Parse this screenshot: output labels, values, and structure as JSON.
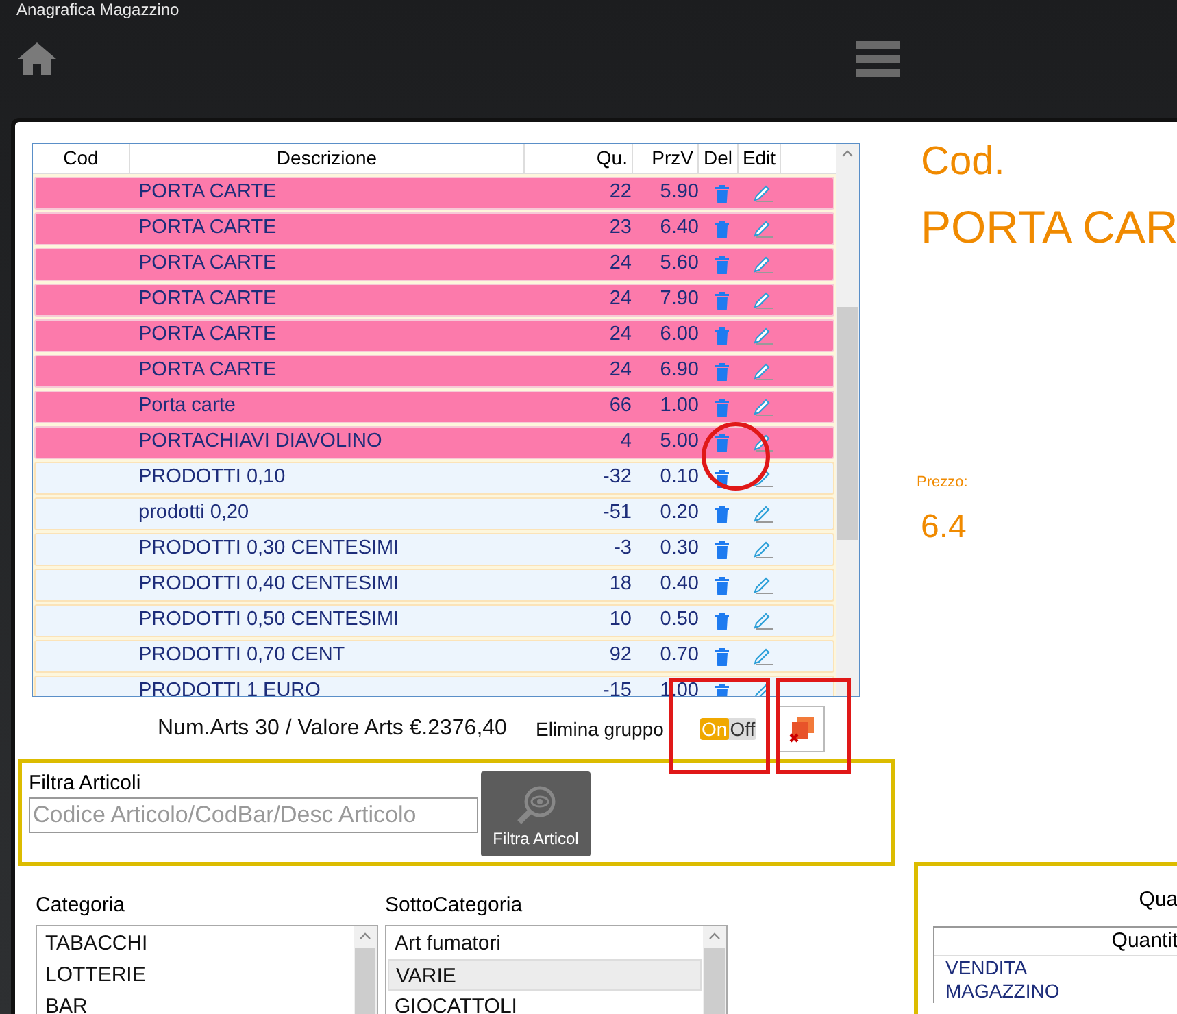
{
  "window": {
    "title": "Anagrafica Magazzino"
  },
  "table": {
    "columns": [
      "Cod",
      "Descrizione",
      "Qu.",
      "PrzV",
      "Del",
      "Edit"
    ],
    "rows": [
      {
        "description": "PORTA CARTE",
        "qty": "22",
        "price": "5.90",
        "selected": true
      },
      {
        "description": "PORTA CARTE",
        "qty": "23",
        "price": "6.40",
        "selected": true
      },
      {
        "description": "PORTA CARTE",
        "qty": "24",
        "price": "5.60",
        "selected": true
      },
      {
        "description": "PORTA CARTE",
        "qty": "24",
        "price": "7.90",
        "selected": true
      },
      {
        "description": "PORTA CARTE",
        "qty": "24",
        "price": "6.00",
        "selected": true
      },
      {
        "description": "PORTA CARTE",
        "qty": "24",
        "price": "6.90",
        "selected": true
      },
      {
        "description": "Porta carte",
        "qty": "66",
        "price": "1.00",
        "selected": true
      },
      {
        "description": "PORTACHIAVI DIAVOLINO",
        "qty": "4",
        "price": "5.00",
        "selected": true
      },
      {
        "description": "PRODOTTI 0,10",
        "qty": "-32",
        "price": "0.10",
        "selected": false
      },
      {
        "description": "prodotti 0,20",
        "qty": "-51",
        "price": "0.20",
        "selected": false
      },
      {
        "description": "PRODOTTI 0,30 CENTESIMI",
        "qty": "-3",
        "price": "0.30",
        "selected": false
      },
      {
        "description": "PRODOTTI 0,40 CENTESIMI",
        "qty": "18",
        "price": "0.40",
        "selected": false
      },
      {
        "description": "PRODOTTI 0,50 CENTESIMI",
        "qty": "10",
        "price": "0.50",
        "selected": false
      },
      {
        "description": "PRODOTTI 0,70 CENT",
        "qty": "92",
        "price": "0.70",
        "selected": false
      },
      {
        "description": "PRODOTTI 1 EURO",
        "qty": "-15",
        "price": "1.00",
        "selected": false
      }
    ]
  },
  "summary": "Num.Arts 30 / Valore Arts €.2376,40",
  "group_delete": {
    "label": "Elimina gruppo",
    "on": true,
    "on_text": "On",
    "off_text": "Off"
  },
  "filter": {
    "label": "Filtra Articoli",
    "placeholder": "Codice Articolo/CodBar/Desc Articolo",
    "button": "Filtra Articol"
  },
  "categories": {
    "label": "Categoria",
    "items": [
      {
        "text": "TABACCHI",
        "selected": false
      },
      {
        "text": "LOTTERIE",
        "selected": false
      },
      {
        "text": "BAR",
        "selected": false
      }
    ]
  },
  "subcategories": {
    "label": "SottoCategoria",
    "items": [
      {
        "text": "Art fumatori",
        "selected": false
      },
      {
        "text": "VARIE",
        "selected": true
      },
      {
        "text": "GIOCATTOLI",
        "selected": false
      }
    ]
  },
  "detail": {
    "code_label": "Cod.",
    "name": "PORTA CAR",
    "price_label": "Prezzo:",
    "price": "6.4"
  },
  "quantity_panel": {
    "title": "Qua",
    "column": "Quantit",
    "rows": [
      "VENDITA",
      "MAGAZZINO"
    ]
  }
}
